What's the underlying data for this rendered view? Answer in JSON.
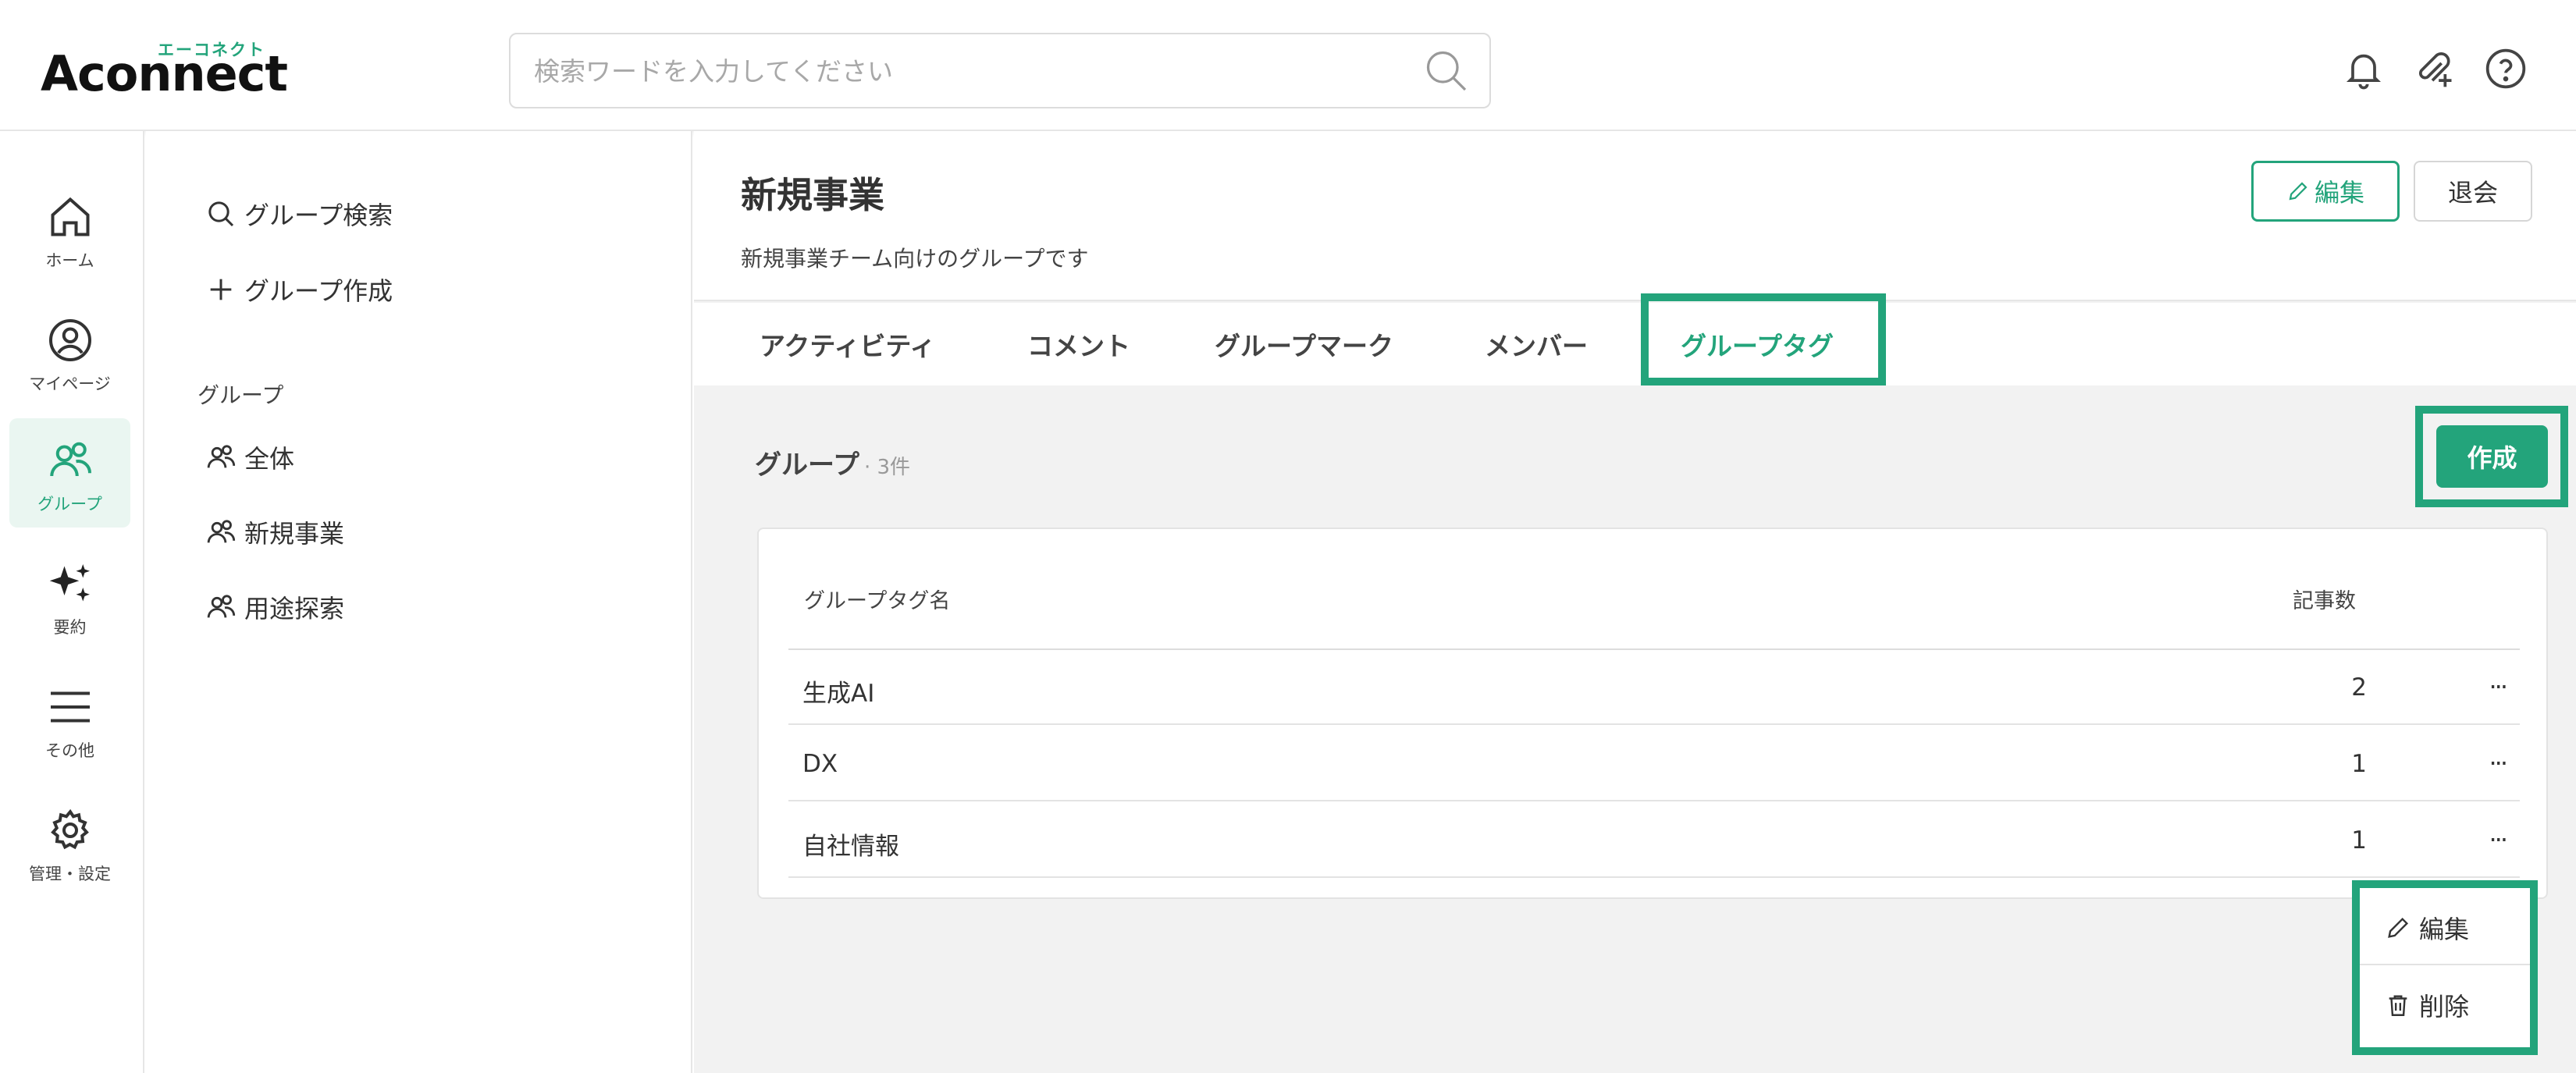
{
  "colors": {
    "accent": "#23a47b",
    "border": "#e6e6e6",
    "main_bg": "#f2f2f2"
  },
  "header": {
    "logo": {
      "kana": "エーコネクト",
      "word": "Aconnect"
    },
    "search": {
      "placeholder": "検索ワードを入力してください",
      "icon": "search-icon"
    },
    "icons": [
      "bell-icon",
      "paperclip-plus-icon",
      "help-icon"
    ]
  },
  "rail": {
    "items": [
      {
        "label": "ホーム",
        "icon": "home-icon",
        "active": false
      },
      {
        "label": "マイページ",
        "icon": "user-circle-icon",
        "active": false
      },
      {
        "label": "グループ",
        "icon": "group-icon",
        "active": true
      },
      {
        "label": "要約",
        "icon": "sparkle-icon",
        "active": false
      },
      {
        "label": "その他",
        "icon": "menu-icon",
        "active": false
      },
      {
        "label": "管理・設定",
        "icon": "gear-icon",
        "active": false
      }
    ]
  },
  "sidebar": {
    "search_label": "グループ検索",
    "create_label": "グループ作成",
    "section_heading": "グループ",
    "groups": [
      "全体",
      "新規事業",
      "用途探索"
    ]
  },
  "group": {
    "title": "新規事業",
    "description": "新規事業チーム向けのグループです",
    "edit_label": "編集",
    "leave_label": "退会"
  },
  "tabs": [
    "アクティビティ",
    "コメント",
    "グループマーク",
    "メンバー",
    "グループタグ"
  ],
  "active_tab": "グループタグ",
  "tags_section": {
    "title": "グループ",
    "count": "· 3件",
    "create_label": "作成",
    "columns": {
      "name": "グループタグ名",
      "count": "記事数"
    },
    "rows": [
      {
        "name": "生成AI",
        "count": "2"
      },
      {
        "name": "DX",
        "count": "1"
      },
      {
        "name": "自社情報",
        "count": "1"
      }
    ],
    "more_label": "···"
  },
  "row_menu": {
    "edit_label": "編集",
    "delete_label": "削除"
  }
}
